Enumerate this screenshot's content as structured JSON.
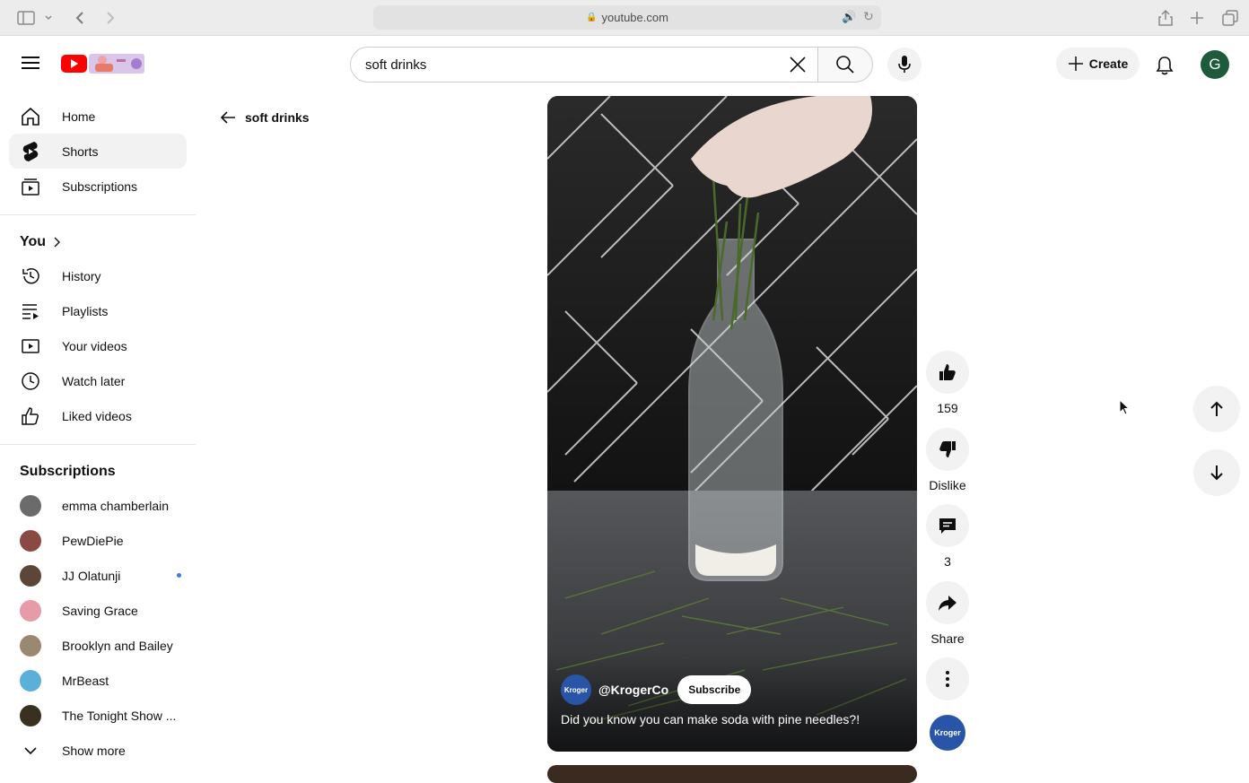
{
  "browser": {
    "url": "youtube.com"
  },
  "header": {
    "search_value": "soft drinks",
    "create_label": "Create",
    "account_initial": "G"
  },
  "sidebar": {
    "main_items": [
      {
        "label": "Home",
        "icon": "home-icon"
      },
      {
        "label": "Shorts",
        "icon": "shorts-icon",
        "active": true
      },
      {
        "label": "Subscriptions",
        "icon": "subscriptions-icon"
      }
    ],
    "you_title": "You",
    "you_items": [
      {
        "label": "History",
        "icon": "history-icon"
      },
      {
        "label": "Playlists",
        "icon": "playlists-icon"
      },
      {
        "label": "Your videos",
        "icon": "your-videos-icon"
      },
      {
        "label": "Watch later",
        "icon": "watch-later-icon"
      },
      {
        "label": "Liked videos",
        "icon": "liked-videos-icon"
      }
    ],
    "subscriptions_title": "Subscriptions",
    "subscriptions": [
      {
        "label": "emma chamberlain",
        "color": "#6b6b6b"
      },
      {
        "label": "PewDiePie",
        "color": "#8a4a44"
      },
      {
        "label": "JJ Olatunji",
        "color": "#5b4638",
        "new": true
      },
      {
        "label": "Saving Grace",
        "color": "#e79aa8"
      },
      {
        "label": "Brooklyn and Bailey",
        "color": "#9a8870"
      },
      {
        "label": "MrBeast",
        "color": "#5ab0d8"
      },
      {
        "label": "The Tonight Show ...",
        "color": "#3a3020"
      }
    ],
    "show_more": "Show more"
  },
  "breadcrumb": {
    "back_label": "soft drinks"
  },
  "short": {
    "channel_handle": "@KrogerCo",
    "channel_avatar_text": "Kroger",
    "subscribe_label": "Subscribe",
    "caption": "Did you know you can make soda with pine needles?!"
  },
  "actions": {
    "like_count": "159",
    "dislike_label": "Dislike",
    "comment_count": "3",
    "share_label": "Share"
  },
  "colors": {
    "accent": "#ff0000",
    "channel_blue": "#2855a8"
  }
}
